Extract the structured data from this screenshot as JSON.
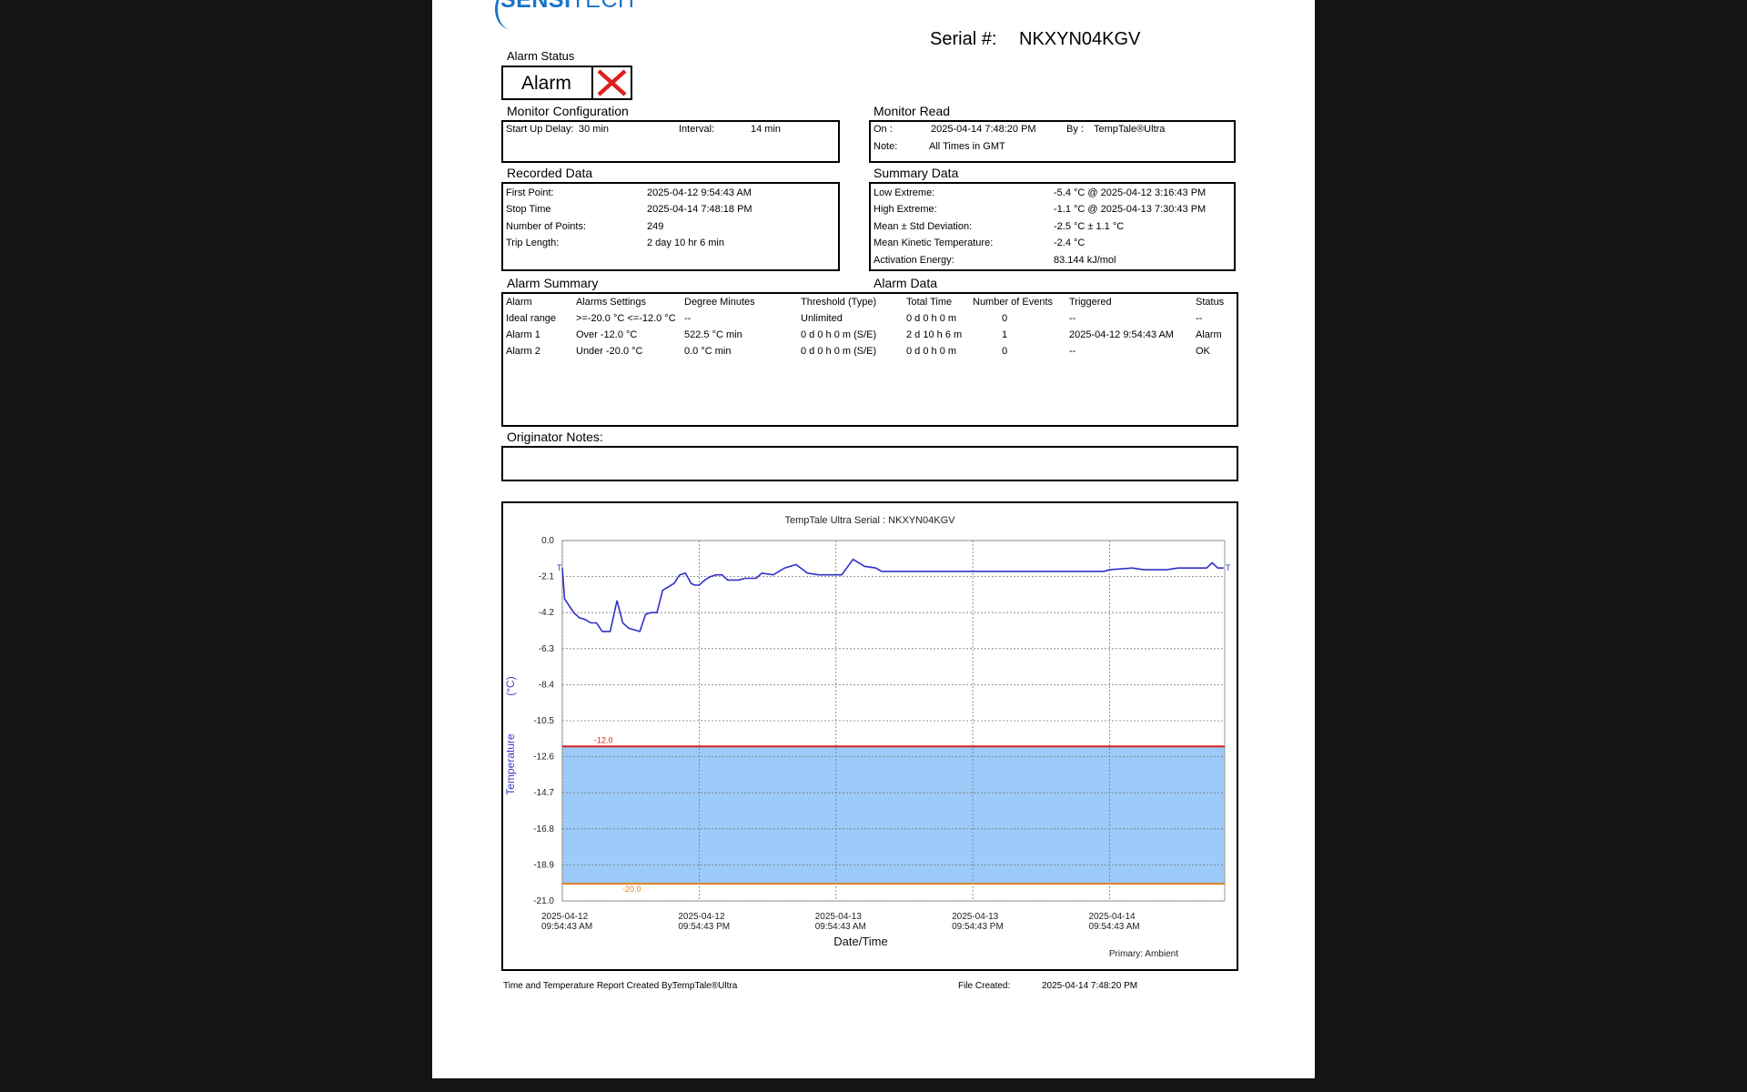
{
  "header": {
    "logo_main": "SENSI",
    "logo_sub": "TECH",
    "serial_label": "Serial #:",
    "serial_value": "NKXYN04KGV"
  },
  "alarm_status": {
    "title": "Alarm Status",
    "value": "Alarm",
    "icon": "x-icon",
    "icon_color": "#e02020"
  },
  "monitor_config": {
    "title": "Monitor Configuration",
    "start_delay_label": "Start Up Delay:",
    "start_delay_value": "30 min",
    "interval_label": "Interval:",
    "interval_value": "14 min"
  },
  "monitor_read": {
    "title": "Monitor Read",
    "on_label": "On :",
    "on_value": "2025-04-14  7:48:20 PM",
    "by_label": "By :",
    "by_value": "TempTale®Ultra",
    "note_label": "Note:",
    "note_value": "All Times in GMT"
  },
  "recorded_data": {
    "title": "Recorded Data",
    "rows": [
      {
        "label": "First Point:",
        "value": "2025-04-12  9:54:43 AM"
      },
      {
        "label": "Stop Time",
        "value": "2025-04-14  7:48:18 PM"
      },
      {
        "label": "Number of Points:",
        "value": "249"
      },
      {
        "label": "Trip Length:",
        "value": "2 day 10 hr 6 min"
      }
    ]
  },
  "summary_data": {
    "title": "Summary Data",
    "rows": [
      {
        "label": "Low Extreme:",
        "value": "-5.4 °C @ 2025-04-12  3:16:43 PM"
      },
      {
        "label": "High Extreme:",
        "value": "-1.1 °C @ 2025-04-13  7:30:43 PM"
      },
      {
        "label": "Mean ± Std Deviation:",
        "value": "-2.5 °C ± 1.1 °C"
      },
      {
        "label": "Mean Kinetic Temperature:",
        "value": "-2.4 °C"
      },
      {
        "label": "Activation Energy:",
        "value": "83.144 kJ/mol"
      }
    ]
  },
  "alarm_summary": {
    "title": "Alarm Summary",
    "data_title": "Alarm Data",
    "headers": [
      "Alarm",
      "Alarms Settings",
      "Degree Minutes",
      "Threshold (Type)",
      "Total Time",
      "Number of Events",
      "Triggered",
      "Status"
    ],
    "rows": [
      [
        "Ideal range",
        ">=-20.0 °C <=-12.0 °C",
        "--",
        "Unlimited",
        "0 d 0 h 0 m",
        "0",
        "--",
        "--"
      ],
      [
        "Alarm 1",
        "Over -12.0 °C",
        "522.5 °C min",
        "0 d 0 h 0 m (S/E)",
        "2 d 10 h 6 m",
        "1",
        "2025-04-12  9:54:43 AM",
        "Alarm"
      ],
      [
        "Alarm 2",
        "Under -20.0 °C",
        "0.0 °C min",
        "0 d 0 h 0 m (S/E)",
        "0 d 0 h 0 m",
        "0",
        "--",
        "OK"
      ]
    ]
  },
  "originator_notes": {
    "title": "Originator Notes:",
    "value": ""
  },
  "chart_data": {
    "type": "line",
    "title": "TempTale Ultra  Serial : NKXYN04KGV",
    "xlabel": "Date/Time",
    "ylabel": "Temperature",
    "ylabel_unit": "(°C)",
    "primary_label": "Primary: Ambient",
    "ylim": [
      -21.0,
      0.0
    ],
    "yticks": [
      "0.0",
      "-2.1",
      "-4.2",
      "-6.3",
      "-8.4",
      "-10.5",
      "-12.6",
      "-14.7",
      "-16.8",
      "-18.9",
      "-21.0"
    ],
    "xticks": [
      {
        "date": "2025-04-12",
        "time": "09:54:43 AM"
      },
      {
        "date": "2025-04-12",
        "time": "09:54:43 PM"
      },
      {
        "date": "2025-04-13",
        "time": "09:54:43 AM"
      },
      {
        "date": "2025-04-13",
        "time": "09:54:43 PM"
      },
      {
        "date": "2025-04-14",
        "time": "09:54:43 AM"
      }
    ],
    "xlim_hours": [
      0,
      58.1
    ],
    "ideal_range": {
      "low": -20.0,
      "high": -12.0,
      "color": "#9ccbf9"
    },
    "upper_limit": {
      "value": -12.0,
      "label": "-12.0",
      "color": "#d02020"
    },
    "lower_limit": {
      "value": -20.0,
      "label": "-20.0",
      "color": "#e08020"
    },
    "start_marker": "T",
    "end_marker": "T",
    "series": [
      {
        "color": "#3030c8",
        "x": [
          0,
          0.2,
          0.5,
          1.0,
          1.5,
          2.0,
          2.5,
          3.0,
          3.5,
          4.2,
          4.8,
          5.3,
          5.8,
          6.3,
          6.8,
          7.3,
          7.8,
          8.3,
          8.8,
          9.3,
          9.8,
          10.3,
          10.8,
          11.3,
          11.6,
          12.0,
          12.5,
          13.0,
          13.5,
          14.0,
          14.5,
          15.0,
          15.5,
          16.0,
          17.0,
          17.5,
          18.5,
          19.5,
          20.5,
          21.5,
          22.5,
          23.5,
          24.5,
          25.5,
          26.5,
          27.5,
          28.0,
          28.5,
          29.5,
          30.5,
          31.5,
          32.5,
          33.0,
          33.5,
          34.0,
          34.5,
          35.0,
          35.5,
          36.0,
          37.0,
          38.0,
          40.0,
          42.0,
          44.0,
          46.0,
          47.0,
          47.5,
          48.0,
          50.0,
          51.0,
          52.0,
          53.0,
          54.0,
          55.0,
          56.0,
          56.5,
          57.0,
          57.5,
          58.0
        ],
        "y": [
          -1.6,
          -3.4,
          -3.7,
          -4.2,
          -4.5,
          -4.6,
          -4.8,
          -4.8,
          -5.3,
          -5.3,
          -3.5,
          -4.8,
          -5.1,
          -5.2,
          -5.3,
          -4.3,
          -4.2,
          -4.2,
          -2.9,
          -2.7,
          -2.5,
          -2.0,
          -1.9,
          -2.5,
          -2.6,
          -2.6,
          -2.3,
          -2.1,
          -2.0,
          -2.0,
          -2.3,
          -2.3,
          -2.3,
          -2.2,
          -2.2,
          -1.9,
          -2.0,
          -1.6,
          -1.4,
          -1.9,
          -2.0,
          -2.0,
          -2.0,
          -1.1,
          -1.5,
          -1.6,
          -1.8,
          -1.8,
          -1.8,
          -1.8,
          -1.8,
          -1.8,
          -1.8,
          -1.8,
          -1.8,
          -1.8,
          -1.8,
          -1.8,
          -1.8,
          -1.8,
          -1.8,
          -1.8,
          -1.8,
          -1.8,
          -1.8,
          -1.8,
          -1.8,
          -1.7,
          -1.6,
          -1.7,
          -1.7,
          -1.7,
          -1.6,
          -1.6,
          -1.6,
          -1.6,
          -1.3,
          -1.6,
          -1.6
        ]
      }
    ]
  },
  "footer": {
    "created_by_label": "Time and Temperature Report Created By:",
    "created_by_value": "TempTale®Ultra",
    "file_created_label": "File Created:",
    "file_created_value": "2025-04-14  7:48:20 PM"
  }
}
